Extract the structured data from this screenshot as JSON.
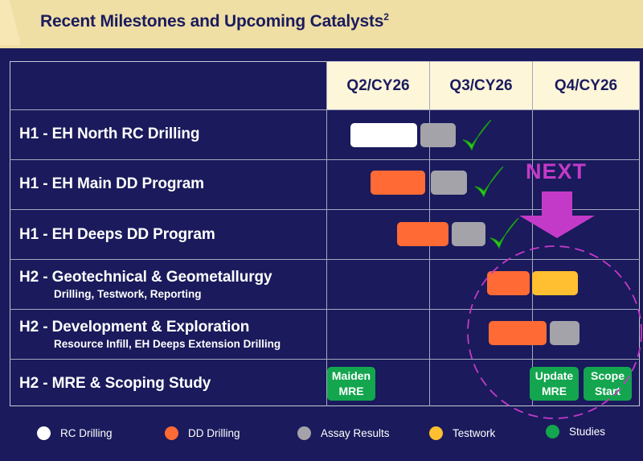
{
  "header": {
    "title": "Recent Milestones and Upcoming Catalysts",
    "footnote": "2"
  },
  "quarters": [
    "Q2/CY26",
    "Q3/CY26",
    "Q4/CY26"
  ],
  "rows": [
    {
      "main": "H1  - EH North RC Drilling",
      "sub": ""
    },
    {
      "main": "H1 - EH Main DD Program",
      "sub": ""
    },
    {
      "main": "H1 - EH Deeps DD Program",
      "sub": ""
    },
    {
      "main": "H2 - Geotechnical & Geometallurgy",
      "sub": "Drilling, Testwork, Reporting"
    },
    {
      "main": "H2 - Development & Exploration",
      "sub": "Resource Infill, EH Deeps Extension Drilling"
    },
    {
      "main": "H2 - MRE & Scoping Study",
      "sub": ""
    }
  ],
  "studies": [
    {
      "line1": "Maiden",
      "line2": "MRE"
    },
    {
      "line1": "Update",
      "line2": "MRE"
    },
    {
      "line1": "Scope",
      "line2": "Start"
    }
  ],
  "next_label": "NEXT",
  "legend": [
    {
      "label": "RC Drilling",
      "color": "#ffffff"
    },
    {
      "label": "DD Drilling",
      "color": "#ff6a35"
    },
    {
      "label": "Assay Results",
      "color": "#a3a3a9"
    },
    {
      "label": "Testwork",
      "color": "#ffbf30"
    },
    {
      "label": "Studies",
      "color": "#14a54f"
    }
  ],
  "colors": {
    "background": "#1a1a5c",
    "header_band": "#efdfa4",
    "quarter_header": "#fdf6d9",
    "check": "#2fcf1f",
    "next": "#c43ac8"
  }
}
